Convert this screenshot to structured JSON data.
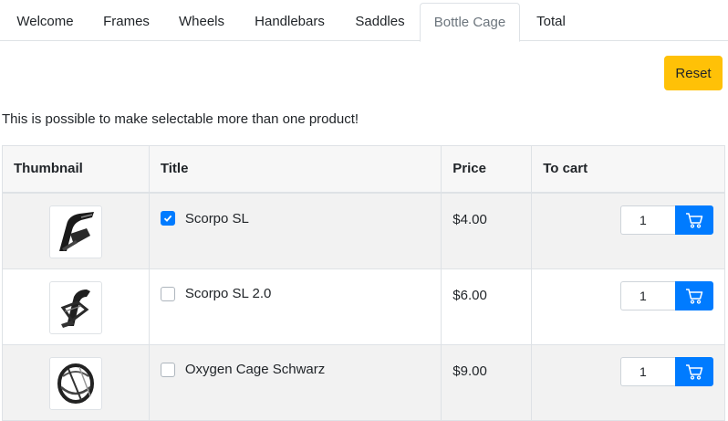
{
  "tabs": [
    {
      "label": "Welcome",
      "active": false
    },
    {
      "label": "Frames",
      "active": false
    },
    {
      "label": "Wheels",
      "active": false
    },
    {
      "label": "Handlebars",
      "active": false
    },
    {
      "label": "Saddles",
      "active": false
    },
    {
      "label": "Bottle Cage",
      "active": true
    },
    {
      "label": "Total",
      "active": false
    }
  ],
  "toolbar": {
    "reset_label": "Reset"
  },
  "note": "This is possible to make selectable more than one product!",
  "table": {
    "headers": [
      "Thumbnail",
      "Title",
      "Price",
      "To cart"
    ],
    "rows": [
      {
        "title": "Scorpo SL",
        "price": "$4.00",
        "quantity": "1",
        "checked": true
      },
      {
        "title": "Scorpo SL 2.0",
        "price": "$6.00",
        "quantity": "1",
        "checked": false
      },
      {
        "title": "Oxygen Cage Schwarz",
        "price": "$9.00",
        "quantity": "1",
        "checked": false
      }
    ]
  },
  "icons": {
    "cart": "shopping-cart-icon",
    "check": "checkmark-icon",
    "thumbnail": "bottle-cage-thumbnail"
  },
  "colors": {
    "accent": "#007bff",
    "reset": "#ffc107",
    "border": "#dee2e6"
  }
}
